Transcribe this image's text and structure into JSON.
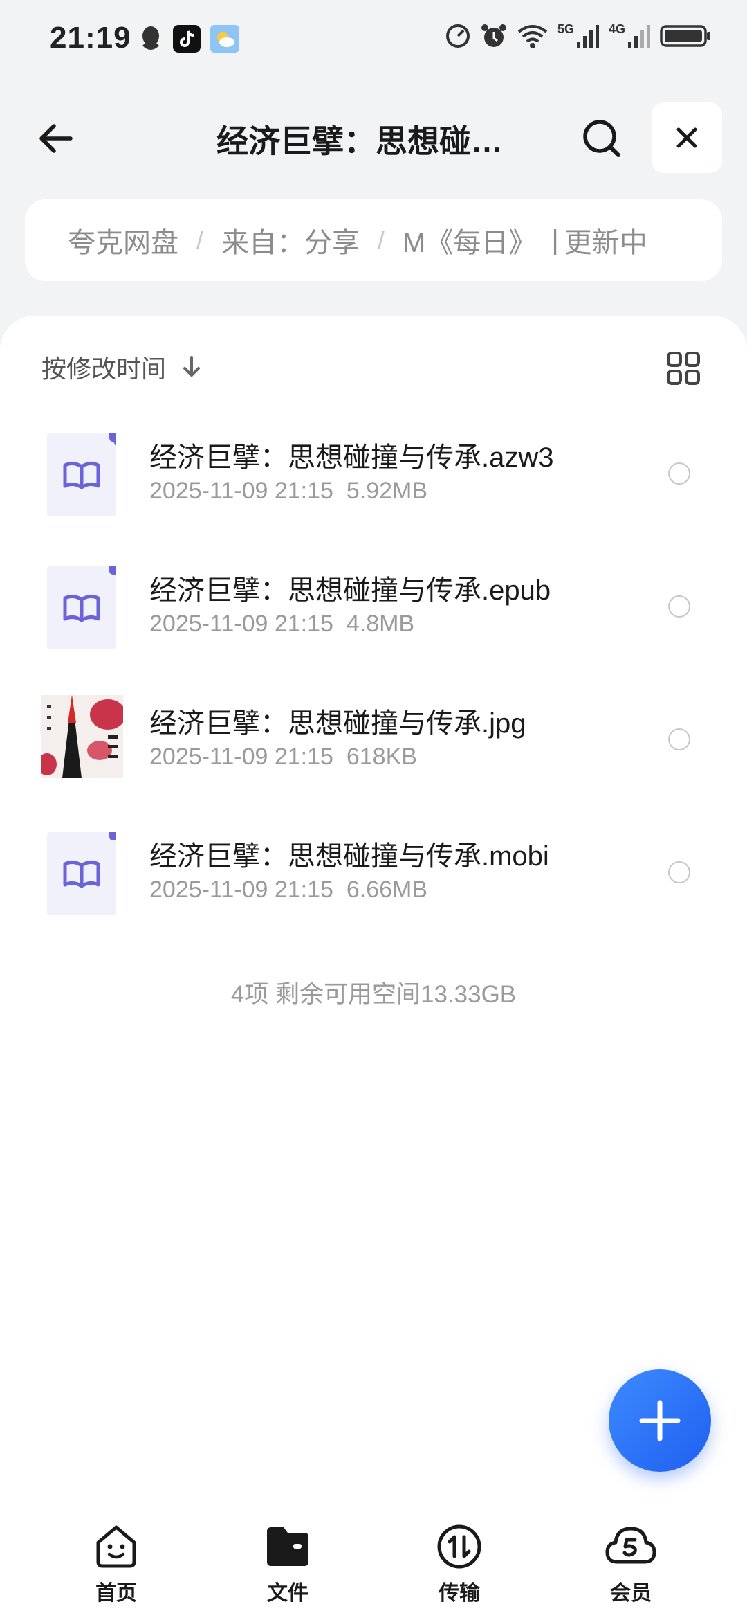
{
  "status_bar": {
    "time": "21:19",
    "network_5g": "5G",
    "network_4g": "4G"
  },
  "header": {
    "title": "经济巨擘：思想碰…"
  },
  "breadcrumb": {
    "items": [
      "夸克网盘",
      "来自：分享",
      "M《每日》",
      "更新中"
    ]
  },
  "sort": {
    "label": "按修改时间"
  },
  "files": [
    {
      "name": "经济巨擘：思想碰撞与传承.azw3",
      "date": "2025-11-09 21:15",
      "size": "5.92MB",
      "icon": "book-icon"
    },
    {
      "name": "经济巨擘：思想碰撞与传承.epub",
      "date": "2025-11-09 21:15",
      "size": "4.8MB",
      "icon": "book-icon"
    },
    {
      "name": "经济巨擘：思想碰撞与传承.jpg",
      "date": "2025-11-09 21:15",
      "size": "618KB",
      "icon": "image-thumbnail"
    },
    {
      "name": "经济巨擘：思想碰撞与传承.mobi",
      "date": "2025-11-09 21:15",
      "size": "6.66MB",
      "icon": "book-icon"
    }
  ],
  "summary": "4项 剩余可用空间13.33GB",
  "bottom_nav": {
    "items": [
      {
        "label": "首页",
        "icon": "smile-face-icon"
      },
      {
        "label": "文件",
        "icon": "folder-icon"
      },
      {
        "label": "传输",
        "icon": "transfer-icon"
      },
      {
        "label": "会员",
        "icon": "cloud-member-icon"
      }
    ]
  },
  "colors": {
    "accent": "#2f6bf5",
    "book_icon": "#6b63d8",
    "background": "#f2f3f5"
  }
}
